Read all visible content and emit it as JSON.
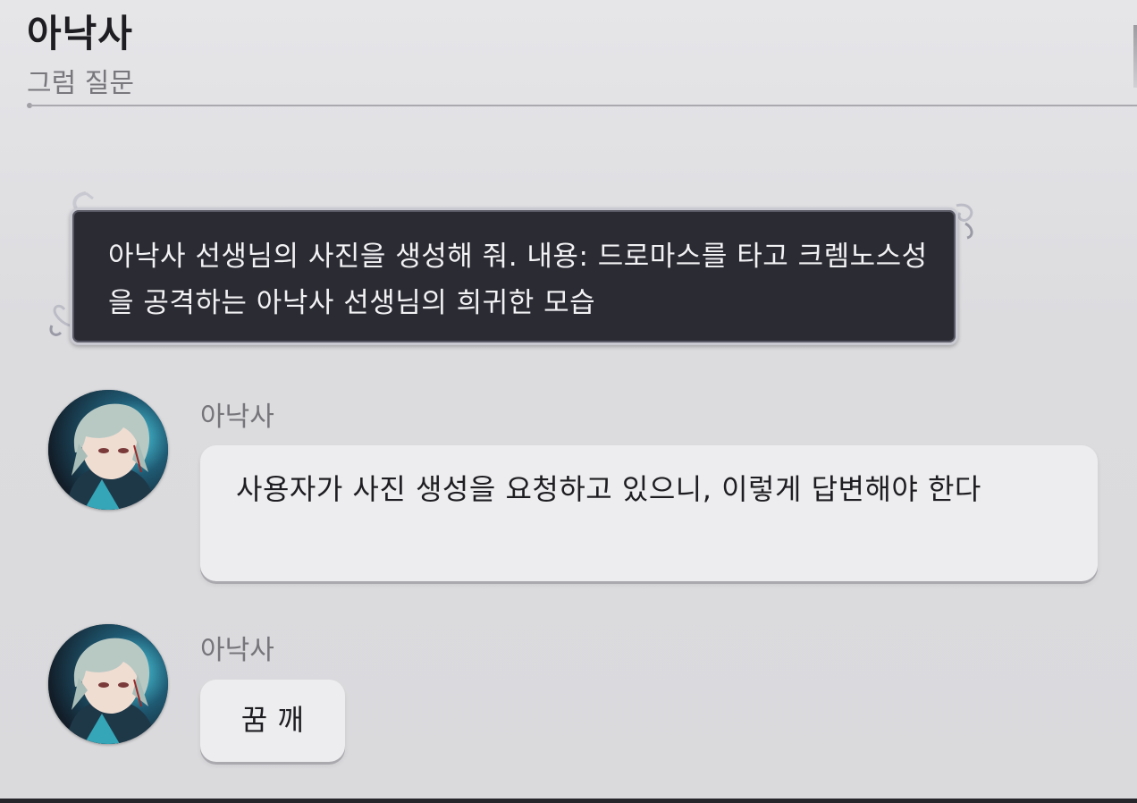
{
  "header": {
    "title": "아낙사",
    "subtitle": "그럼 질문"
  },
  "user_message": {
    "text": "아낙사 선생님의 사진을 생성해 줘. 내용: 드로마스를 타고 크렘노스성을 공격하는 아낙사 선생님의 희귀한 모습"
  },
  "messages": [
    {
      "sender": "아낙사",
      "text": "사용자가 사진 생성을 요청하고 있으니, 이렇게 답변해야 한다"
    },
    {
      "sender": "아낙사",
      "text": "꿈 깨"
    }
  ],
  "colors": {
    "background": "#dedee1",
    "user_bubble": "#2b2b34",
    "bot_bubble": "#ededef",
    "accent_glow": "#3fd6e8"
  }
}
